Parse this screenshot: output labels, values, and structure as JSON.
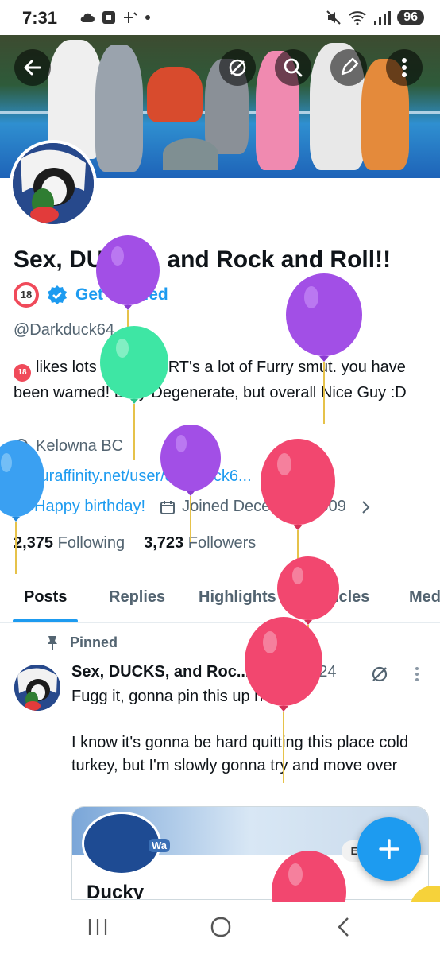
{
  "status_bar": {
    "time": "7:31",
    "battery": "96"
  },
  "profile": {
    "name": "Sex, DUCKS, and Rock and Roll!!",
    "badge_text": "18",
    "verify_label": "Get Verified",
    "handle": "@Darkduck64",
    "bio": "likes lots of lewds, RT's a lot of Furry smut. you have been warned!   Dirty Degenerate, but overall Nice Guy :D",
    "location": "Kelowna BC",
    "website": "furaffinity.net/user/darkduck6...",
    "birthday": "Happy birthday!",
    "joined": "Joined December 2009",
    "following_count": "2,375",
    "following_label": "Following",
    "followers_count": "3,723",
    "followers_label": "Followers"
  },
  "tabs": [
    {
      "label": "Posts"
    },
    {
      "label": "Replies"
    },
    {
      "label": "Highlights"
    },
    {
      "label": "Articles"
    },
    {
      "label": "Med"
    }
  ],
  "pinned_post": {
    "pinned_label": "Pinned",
    "author": "Sex, DUCKS, and Roc...",
    "date": "· 06 Nov 24",
    "line1": "Fugg it, gonna pin this up here",
    "line2": "I know it's gonna be hard quitting this place cold turkey, but I'm slowly gonna try and move over",
    "embed_button": "Edit Profil",
    "embed_name": "Ducky",
    "embed_badge": "Wa"
  },
  "fab_label": "+",
  "colors": {
    "accent": "#1d9bf0",
    "text": "#0f1419",
    "muted": "#536471"
  },
  "icons": [
    "back-arrow-icon",
    "grok-icon",
    "search-icon",
    "edit-icon",
    "more-vertical-icon",
    "location-icon",
    "link-icon",
    "balloon-icon",
    "calendar-icon",
    "pin-icon",
    "plus-icon"
  ]
}
